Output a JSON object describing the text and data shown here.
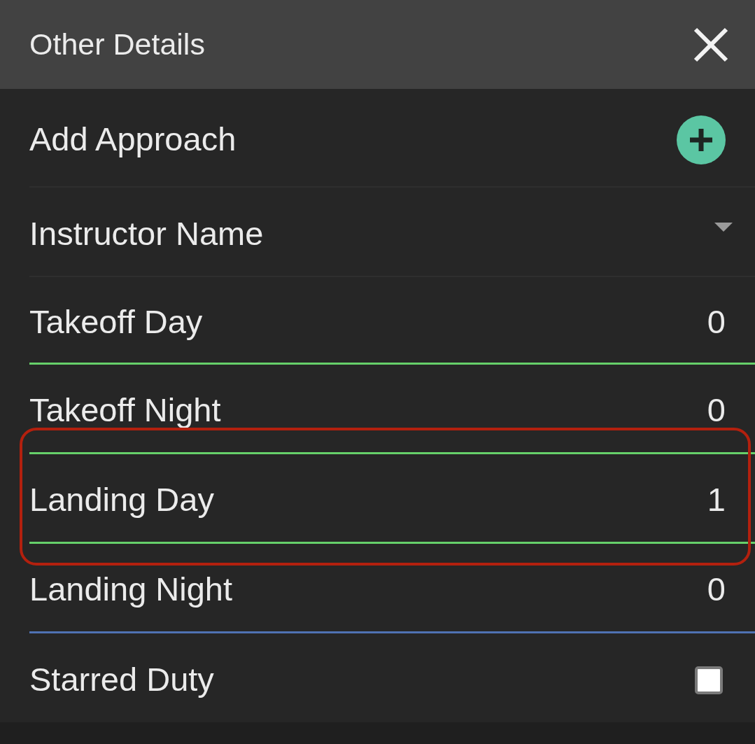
{
  "header": {
    "title": "Other Details"
  },
  "rows": [
    {
      "kind": "action",
      "label": "Add Approach"
    },
    {
      "kind": "dropdown",
      "label": "Instructor Name"
    },
    {
      "kind": "number",
      "label": "Takeoff Day",
      "value": "0",
      "color": "#66d06a",
      "highlighted": false
    },
    {
      "kind": "number",
      "label": "Takeoff Night",
      "value": "0",
      "color": "#66d06a",
      "highlighted": false
    },
    {
      "kind": "number",
      "label": "Landing Day",
      "value": "1",
      "color": "#66d06a",
      "highlighted": true
    },
    {
      "kind": "number",
      "label": "Landing Night",
      "value": "0",
      "color": "#4f72b3",
      "highlighted": false
    },
    {
      "kind": "checkbox",
      "label": "Starred Duty",
      "checked": false
    }
  ]
}
